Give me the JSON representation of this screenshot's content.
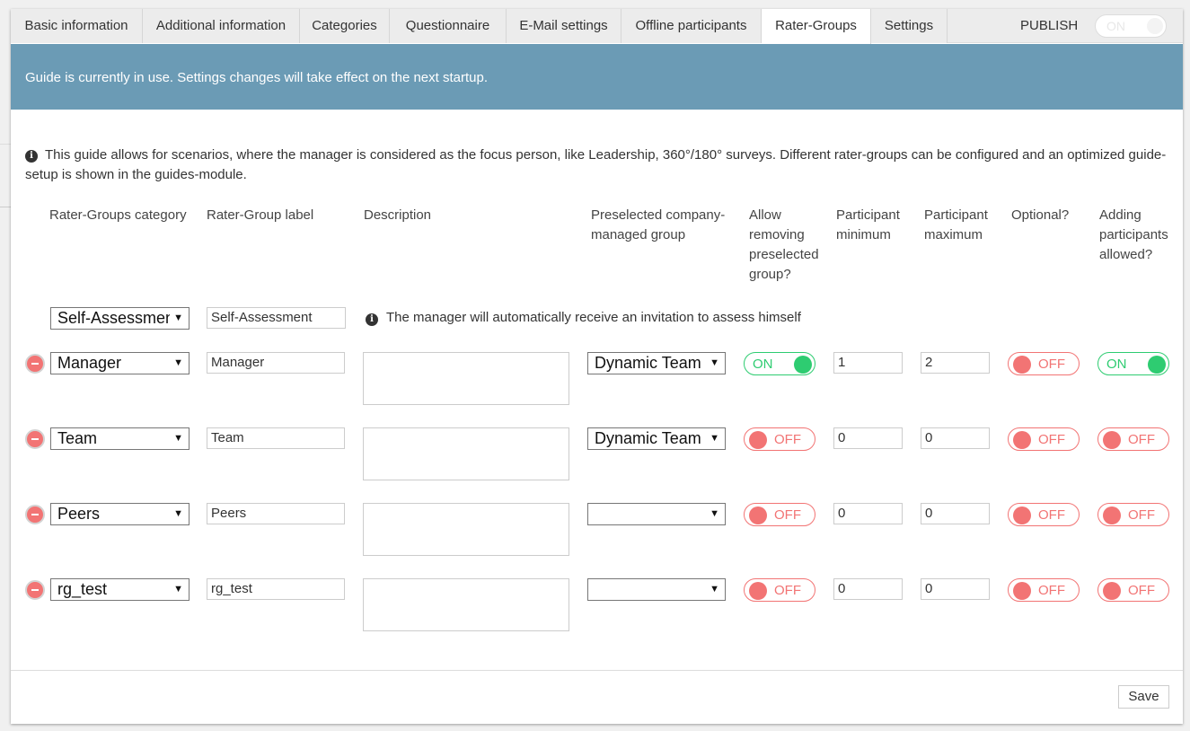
{
  "tabs": [
    {
      "label": "Basic information"
    },
    {
      "label": "Additional information"
    },
    {
      "label": "Categories"
    },
    {
      "label": "Questionnaire"
    },
    {
      "label": "E-Mail settings"
    },
    {
      "label": "Offline participants"
    },
    {
      "label": "Rater-Groups"
    },
    {
      "label": "Settings"
    }
  ],
  "active_tab": "Rater-Groups",
  "publish": {
    "label": "PUBLISH",
    "toggle": "ON"
  },
  "banner": "Guide is currently in use. Settings changes will take effect on the next startup.",
  "guide_info": "This guide allows for scenarios, where the manager is considered as the focus person, like Leadership, 360°/180° surveys. Different rater-groups can be configured and an optimized guide-setup is shown in the guides-module.",
  "columns": {
    "category": "Rater-Groups category",
    "label": "Rater-Group label",
    "description": "Description",
    "preselected": "Preselected company-managed group",
    "allow_removing": "Allow removing preselected group?",
    "min": "Participant minimum",
    "max": "Participant maximum",
    "optional": "Optional?",
    "adding": "Adding participants allowed?"
  },
  "self_assessment": {
    "category": "Self-Assessment",
    "label": "Self-Assessment",
    "note": "The manager will automatically receive an invitation to assess himself"
  },
  "rows": [
    {
      "category": "Manager",
      "label": "Manager",
      "preselected": "Dynamic Team",
      "allow_removing": "ON",
      "min": "1",
      "max": "2",
      "optional": "OFF",
      "adding": "ON"
    },
    {
      "category": "Team",
      "label": "Team",
      "preselected": "Dynamic Team",
      "allow_removing": "OFF",
      "min": "0",
      "max": "0",
      "optional": "OFF",
      "adding": "OFF"
    },
    {
      "category": "Peers",
      "label": "Peers",
      "preselected": "",
      "allow_removing": "OFF",
      "min": "0",
      "max": "0",
      "optional": "OFF",
      "adding": "OFF"
    },
    {
      "category": "rg_test",
      "label": "rg_test",
      "preselected": "",
      "allow_removing": "OFF",
      "min": "0",
      "max": "0",
      "optional": "OFF",
      "adding": "OFF"
    }
  ],
  "save_label": "Save",
  "colors": {
    "banner": "#6b9bb5",
    "on": "#2ecc71",
    "off": "#f27474"
  }
}
